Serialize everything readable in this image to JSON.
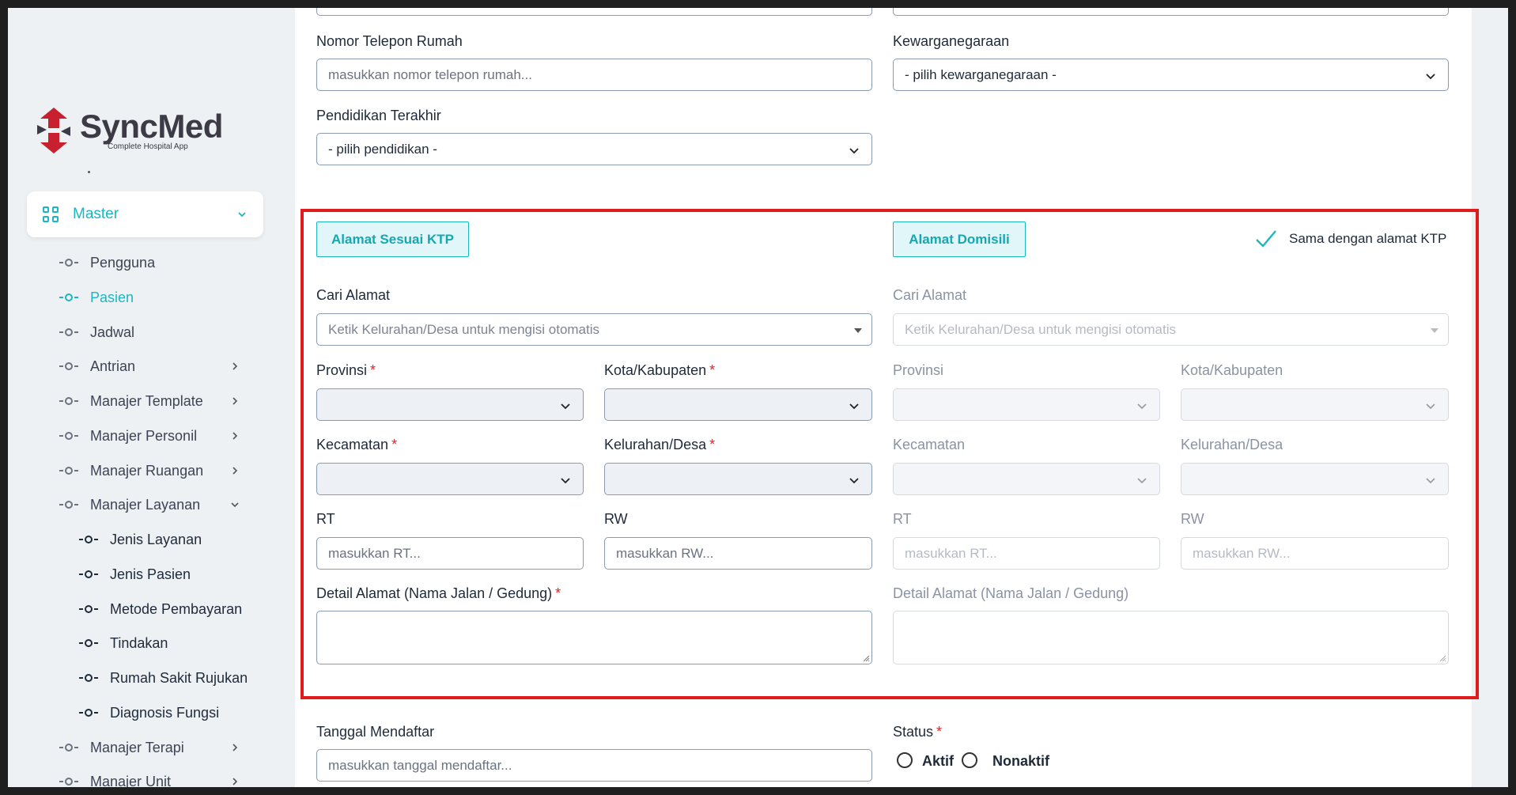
{
  "brand": {
    "name": "SyncMed",
    "tagline": "Complete Hospital App",
    "colors": {
      "accent": "#1bb6c1",
      "logo_red": "#c8202e",
      "highlight": "#e01b1b"
    }
  },
  "sidebar": {
    "master_label": "Master",
    "items": [
      {
        "label": "Pengguna"
      },
      {
        "label": "Pasien"
      },
      {
        "label": "Jadwal"
      },
      {
        "label": "Antrian"
      },
      {
        "label": "Manajer Template"
      },
      {
        "label": "Manajer Personil"
      },
      {
        "label": "Manajer Ruangan"
      },
      {
        "label": "Manajer Layanan"
      },
      {
        "label": "Jenis Layanan"
      },
      {
        "label": "Jenis Pasien"
      },
      {
        "label": "Metode Pembayaran"
      },
      {
        "label": "Tindakan"
      },
      {
        "label": "Rumah Sakit Rujukan"
      },
      {
        "label": "Diagnosis Fungsi"
      },
      {
        "label": "Manajer Terapi"
      },
      {
        "label": "Manajer Unit"
      }
    ]
  },
  "form": {
    "phone": {
      "label": "Nomor Telepon Rumah",
      "placeholder": "masukkan nomor telepon rumah..."
    },
    "citizenship": {
      "label": "Kewarganegaraan",
      "value": "- pilih kewarganegaraan -"
    },
    "education": {
      "label": "Pendidikan Terakhir",
      "value": "- pilih pendidikan -"
    },
    "ktp": {
      "title": "Alamat Sesuai KTP",
      "search_label": "Cari Alamat",
      "search_placeholder": "Ketik Kelurahan/Desa untuk mengisi otomatis",
      "provinsi": "Provinsi",
      "kota": "Kota/Kabupaten",
      "kecamatan": "Kecamatan",
      "kelurahan": "Kelurahan/Desa",
      "rt": "RT",
      "rt_placeholder": "masukkan RT...",
      "rw": "RW",
      "rw_placeholder": "masukkan RW...",
      "detail": "Detail Alamat (Nama Jalan / Gedung)",
      "required_mark": "*"
    },
    "domisili": {
      "title": "Alamat Domisili",
      "same_label": "Sama dengan alamat KTP",
      "search_label": "Cari Alamat",
      "search_placeholder": "Ketik Kelurahan/Desa untuk mengisi otomatis",
      "provinsi": "Provinsi",
      "kota": "Kota/Kabupaten",
      "kecamatan": "Kecamatan",
      "kelurahan": "Kelurahan/Desa",
      "rt": "RT",
      "rt_placeholder": "masukkan RT...",
      "rw": "RW",
      "rw_placeholder": "masukkan RW...",
      "detail": "Detail Alamat (Nama Jalan / Gedung)"
    },
    "registration": {
      "label": "Tanggal Mendaftar",
      "placeholder": "masukkan tanggal mendaftar..."
    },
    "status": {
      "label": "Status",
      "required_mark": "*",
      "options": [
        "Aktif",
        "Nonaktif"
      ]
    }
  }
}
